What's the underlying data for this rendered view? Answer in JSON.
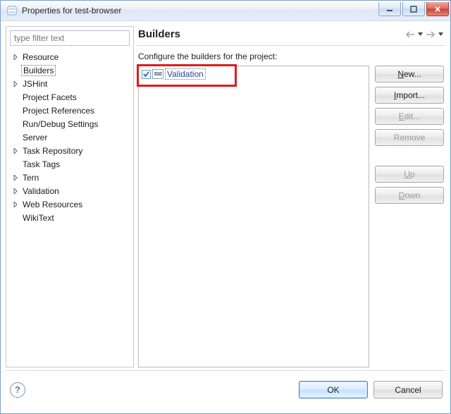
{
  "window": {
    "title": "Properties for test-browser"
  },
  "filter": {
    "placeholder": "type filter text"
  },
  "tree": {
    "items": [
      {
        "label": "Resource",
        "expandable": true,
        "selected": false
      },
      {
        "label": "Builders",
        "expandable": false,
        "selected": true
      },
      {
        "label": "JSHint",
        "expandable": true,
        "selected": false
      },
      {
        "label": "Project Facets",
        "expandable": false,
        "selected": false
      },
      {
        "label": "Project References",
        "expandable": false,
        "selected": false
      },
      {
        "label": "Run/Debug Settings",
        "expandable": false,
        "selected": false
      },
      {
        "label": "Server",
        "expandable": false,
        "selected": false
      },
      {
        "label": "Task Repository",
        "expandable": true,
        "selected": false
      },
      {
        "label": "Task Tags",
        "expandable": false,
        "selected": false
      },
      {
        "label": "Tern",
        "expandable": true,
        "selected": false
      },
      {
        "label": "Validation",
        "expandable": true,
        "selected": false
      },
      {
        "label": "Web Resources",
        "expandable": true,
        "selected": false
      },
      {
        "label": "WikiText",
        "expandable": false,
        "selected": false
      }
    ]
  },
  "page": {
    "title": "Builders",
    "description": "Configure the builders for the project:",
    "builders": [
      {
        "label": "Validation",
        "checked": true,
        "selected": true
      }
    ]
  },
  "buttons": {
    "new": "New...",
    "import": "Import...",
    "edit": "Edit...",
    "remove": "Remove",
    "up": "Up",
    "down": "Down",
    "ok": "OK",
    "cancel": "Cancel"
  },
  "icons": {
    "builder_badge": "010"
  },
  "colors": {
    "highlight": "#e21a1a",
    "accent": "#3f84c4"
  }
}
